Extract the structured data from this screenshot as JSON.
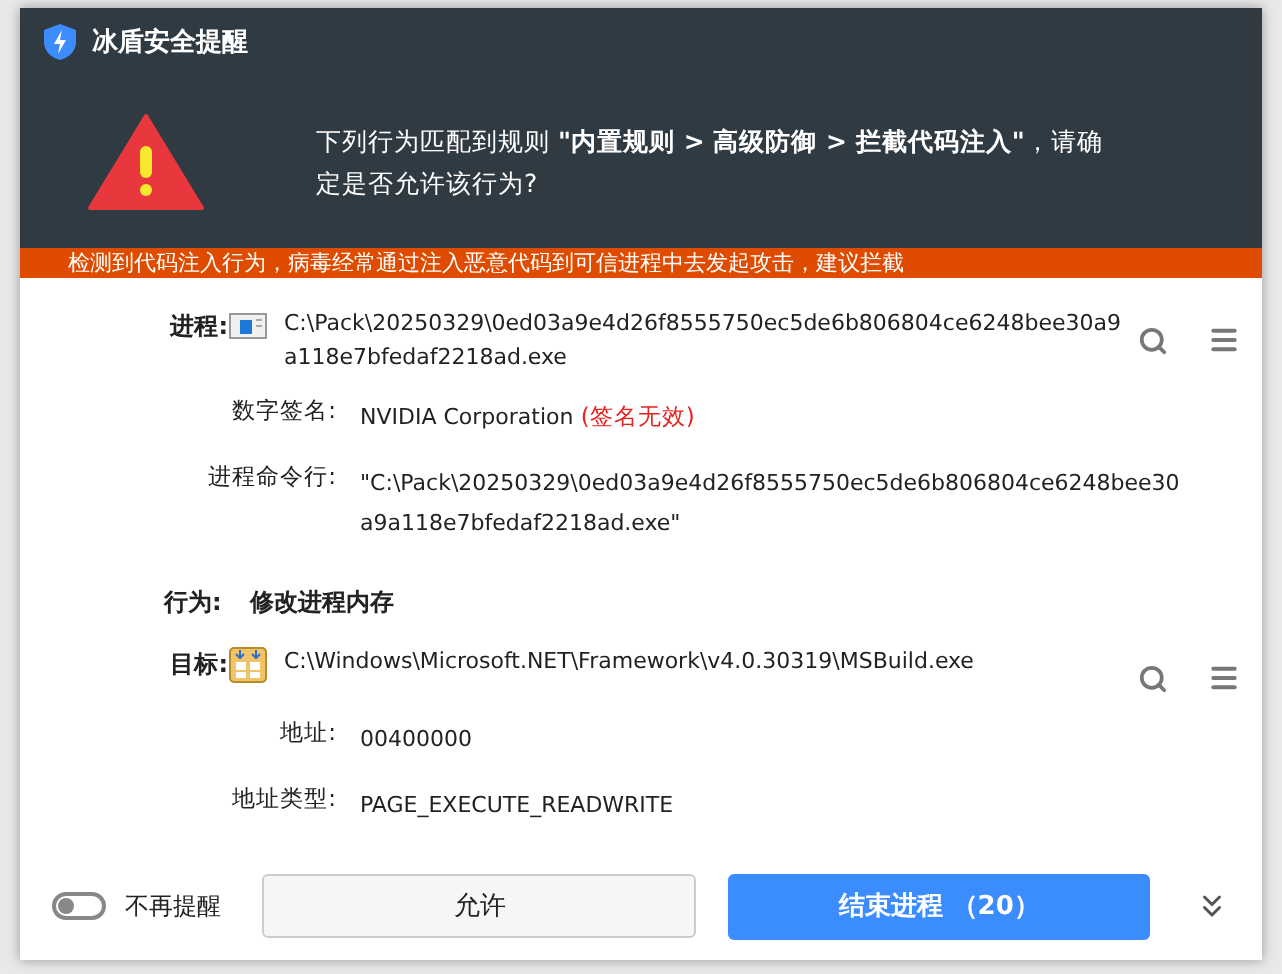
{
  "window": {
    "title": "冰盾安全提醒"
  },
  "message": "下列行为匹配到规则 **\"内置规则 > 高级防御 > 拦截代码注入\"**，请确定是否允许该行为?",
  "banner": "检测到代码注入行为，病毒经常通过注入恶意代码到可信进程中去发起攻击，建议拦截",
  "process": {
    "label": "进程:",
    "path": "C:\\Pack\\20250329\\0ed03a9e4d26f8555750ec5de6b806804ce6248bee30a9a118e7bfedaf2218ad.exe",
    "kind": "app",
    "details": [
      {
        "label": "数字签名:",
        "value": "NVIDIA Corporation",
        "note": "(签名无效)"
      },
      {
        "label": "进程命令行:",
        "value": "\"C:\\Pack\\20250329\\0ed03a9e4d26f8555750ec5de6b806804ce6248bee30a9a118e7bfedaf2218ad.exe\""
      }
    ]
  },
  "behavior": {
    "label": "行为:",
    "value": "修改进程内存"
  },
  "target": {
    "label": "目标:",
    "path": "C:\\Windows\\Microsoft.NET\\Framework\\v4.0.30319\\MSBuild.exe",
    "kind": "build",
    "details": [
      {
        "label": "地址:",
        "value": "00400000"
      },
      {
        "label": "地址类型:",
        "value": "PAGE_EXECUTE_READWRITE"
      }
    ]
  },
  "footer": {
    "toggle": {
      "label": "不再提醒",
      "on": false
    },
    "allow": "允许",
    "end": "结束进程 （20）"
  }
}
